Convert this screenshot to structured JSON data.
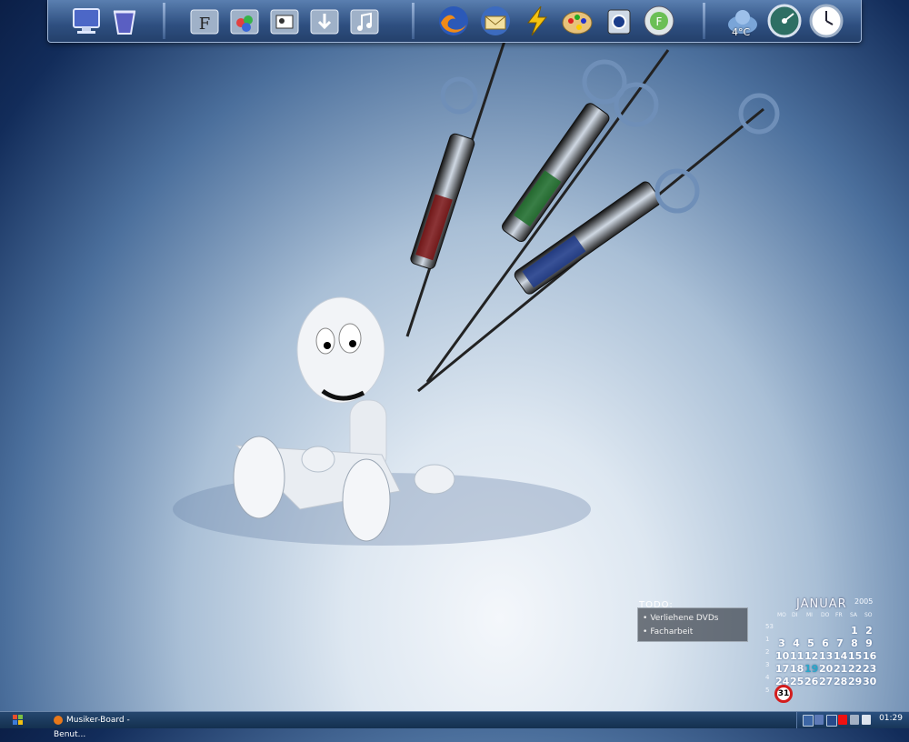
{
  "dock": {
    "groups": [
      {
        "items": [
          {
            "icon": "monitor-icon"
          },
          {
            "icon": "recycle-bin-icon"
          }
        ]
      },
      {
        "items": [
          {
            "icon": "fonts-folder-icon"
          },
          {
            "icon": "paint-folder-icon"
          },
          {
            "icon": "pictures-folder-icon"
          },
          {
            "icon": "downloads-folder-icon"
          },
          {
            "icon": "music-folder-icon"
          }
        ]
      },
      {
        "items": [
          {
            "icon": "firefox-icon"
          },
          {
            "icon": "thunderbird-icon"
          },
          {
            "icon": "winamp-icon"
          },
          {
            "icon": "palette-icon"
          },
          {
            "icon": "camera-icon"
          },
          {
            "icon": "feedreader-icon"
          }
        ]
      },
      {
        "items": [
          {
            "icon": "weather-icon",
            "label": "4°C"
          },
          {
            "icon": "gauge-icon"
          },
          {
            "icon": "clock-icon"
          }
        ]
      }
    ]
  },
  "todo": {
    "title": "TODO:",
    "items": [
      "Verliehene DVDs",
      "Facharbeit"
    ]
  },
  "calendar": {
    "month": "JANUAR",
    "year": "2005",
    "weekdays": [
      "MO",
      "DI",
      "MI",
      "DO",
      "FR",
      "SA",
      "SO"
    ],
    "weeks": [
      {
        "num": "53",
        "days": [
          "",
          "",
          "",
          "",
          "",
          "1",
          "2"
        ]
      },
      {
        "num": "1",
        "days": [
          "3",
          "4",
          "5",
          "6",
          "7",
          "8",
          "9"
        ]
      },
      {
        "num": "2",
        "days": [
          "10",
          "11",
          "12",
          "13",
          "14",
          "15",
          "16"
        ]
      },
      {
        "num": "3",
        "days": [
          "17",
          "18",
          "19",
          "20",
          "21",
          "22",
          "23"
        ]
      },
      {
        "num": "4",
        "days": [
          "24",
          "25",
          "26",
          "27",
          "28",
          "29",
          "30"
        ]
      },
      {
        "num": "5",
        "days": [
          "31",
          "",
          "",
          "",
          "",
          "",
          ""
        ]
      }
    ],
    "highlight_day": "19",
    "current_day": "31"
  },
  "taskbar": {
    "task_label": "Musiker-Board - Benut...",
    "clock": "01:29",
    "colors": {
      "bar": "#1c3b60",
      "accent": "#d31d1d"
    }
  }
}
